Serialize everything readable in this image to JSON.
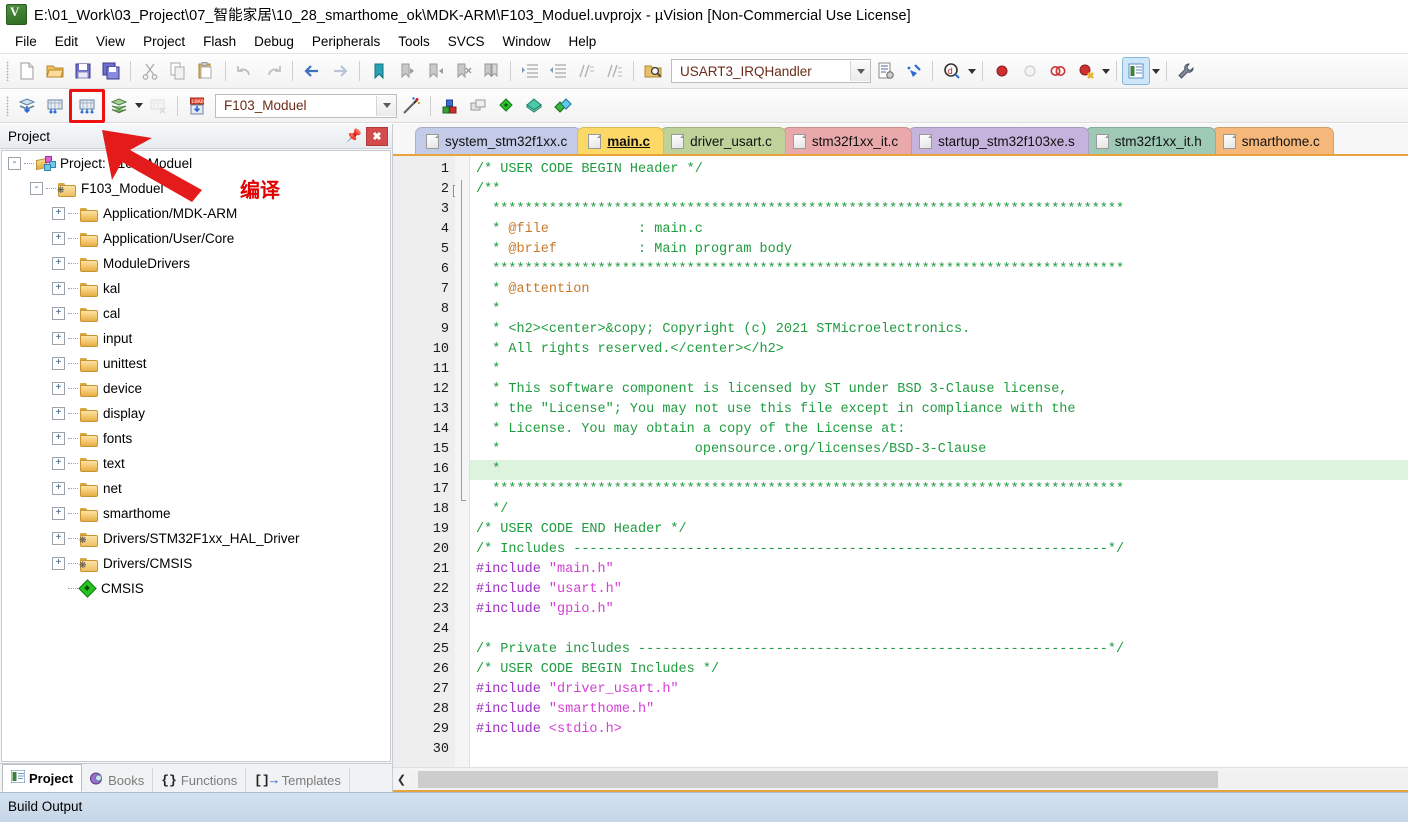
{
  "window": {
    "title": "E:\\01_Work\\03_Project\\07_智能家居\\10_28_smarthome_ok\\MDK-ARM\\F103_Moduel.uvprojx - µVision  [Non-Commercial Use License]",
    "logo_icon": "uvision-logo-icon"
  },
  "menu": {
    "items": [
      {
        "label": "File"
      },
      {
        "label": "Edit"
      },
      {
        "label": "View"
      },
      {
        "label": "Project"
      },
      {
        "label": "Flash"
      },
      {
        "label": "Debug"
      },
      {
        "label": "Peripherals"
      },
      {
        "label": "Tools"
      },
      {
        "label": "SVCS"
      },
      {
        "label": "Window"
      },
      {
        "label": "Help"
      }
    ]
  },
  "toolbar_file": {
    "buttons": [
      {
        "name": "new-file-icon",
        "glyph": "new"
      },
      {
        "name": "open-file-icon",
        "glyph": "open"
      },
      {
        "name": "save-icon",
        "glyph": "save"
      },
      {
        "name": "save-all-icon",
        "glyph": "saveall"
      },
      {
        "name": "cut-icon",
        "glyph": "cut"
      },
      {
        "name": "copy-icon",
        "glyph": "copy"
      },
      {
        "name": "paste-icon",
        "glyph": "paste"
      },
      {
        "name": "undo-icon",
        "glyph": "undo"
      },
      {
        "name": "redo-icon",
        "glyph": "redo"
      },
      {
        "name": "navigate-back-icon",
        "glyph": "back"
      },
      {
        "name": "navigate-forward-icon",
        "glyph": "forward"
      },
      {
        "name": "bookmark-toggle-icon",
        "glyph": "bm"
      },
      {
        "name": "bookmark-prev-icon",
        "glyph": "bmprev"
      },
      {
        "name": "bookmark-next-icon",
        "glyph": "bmnext"
      },
      {
        "name": "bookmark-clear-icon",
        "glyph": "bmclear"
      },
      {
        "name": "bookmark-clear-all-icon",
        "glyph": "bmclearall"
      },
      {
        "name": "indent-icon",
        "glyph": "indent"
      },
      {
        "name": "outdent-icon",
        "glyph": "outdent"
      },
      {
        "name": "comment-icon",
        "glyph": "comment"
      },
      {
        "name": "uncomment-icon",
        "glyph": "uncomment"
      },
      {
        "name": "find-in-files-icon",
        "glyph": "findfiles"
      }
    ],
    "function_combo_value": "USART3_IRQHandler",
    "after_combo": [
      {
        "name": "insert-snippet-icon",
        "glyph": "snippet"
      },
      {
        "name": "configure-icon",
        "glyph": "configure"
      }
    ],
    "right_buttons": [
      {
        "name": "debug-start-icon",
        "glyph": "debug"
      },
      {
        "name": "breakpoint-insert-icon",
        "glyph": "bp"
      },
      {
        "name": "breakpoint-disable-icon",
        "glyph": "bpoff"
      },
      {
        "name": "breakpoint-disable-all-icon",
        "glyph": "bpdisall"
      },
      {
        "name": "breakpoint-kill-all-icon",
        "glyph": "bpkill"
      },
      {
        "name": "manage-windows-icon",
        "glyph": "winmanage"
      },
      {
        "name": "configure-target-icon",
        "glyph": "wrench"
      }
    ]
  },
  "toolbar_build": {
    "buttons": [
      {
        "name": "translate-file-button",
        "glyph": "translate",
        "state": "normal"
      },
      {
        "name": "build-target-button",
        "glyph": "build",
        "state": "normal"
      },
      {
        "name": "rebuild-all-button",
        "glyph": "rebuild",
        "state": "highlighted"
      },
      {
        "name": "batch-build-button",
        "glyph": "batchbuild",
        "state": "normal"
      },
      {
        "name": "stop-build-button",
        "glyph": "stopbuild",
        "state": "disabled"
      },
      {
        "name": "download-button",
        "glyph": "load",
        "state": "normal"
      }
    ],
    "target_combo_value": "F103_Moduel",
    "after_target": [
      {
        "name": "target-options-icon",
        "glyph": "magicwand"
      },
      {
        "name": "manage-project-items-icon",
        "glyph": "projitems"
      },
      {
        "name": "manage-multi-project-icon",
        "glyph": "multiproj"
      },
      {
        "name": "pack-installer-icon",
        "glyph": "packinstaller"
      },
      {
        "name": "manage-run-time-env-icon",
        "glyph": "rte"
      },
      {
        "name": "select-software-packs-icon",
        "glyph": "softpacks"
      }
    ]
  },
  "annotation": {
    "label": "编译",
    "color": "#e00000",
    "arrow_name": "red-annotation-arrow",
    "target": "rebuild-all-button"
  },
  "project_panel": {
    "header_title": "Project",
    "pin_icon": "pin-icon",
    "close_icon": "close-icon",
    "tree": [
      {
        "label": "Project: F103_Moduel",
        "depth": 0,
        "expander": "-",
        "icon": "project-root-icon"
      },
      {
        "label": "F103_Moduel",
        "depth": 1,
        "expander": "-",
        "icon": "target-folder-icon"
      },
      {
        "label": "Application/MDK-ARM",
        "depth": 2,
        "expander": "+",
        "icon": "folder-icon"
      },
      {
        "label": "Application/User/Core",
        "depth": 2,
        "expander": "+",
        "icon": "folder-icon"
      },
      {
        "label": "ModuleDrivers",
        "depth": 2,
        "expander": "+",
        "icon": "folder-icon"
      },
      {
        "label": "kal",
        "depth": 2,
        "expander": "+",
        "icon": "folder-icon"
      },
      {
        "label": "cal",
        "depth": 2,
        "expander": "+",
        "icon": "folder-icon"
      },
      {
        "label": "input",
        "depth": 2,
        "expander": "+",
        "icon": "folder-icon"
      },
      {
        "label": "unittest",
        "depth": 2,
        "expander": "+",
        "icon": "folder-icon"
      },
      {
        "label": "device",
        "depth": 2,
        "expander": "+",
        "icon": "folder-icon"
      },
      {
        "label": "display",
        "depth": 2,
        "expander": "+",
        "icon": "folder-icon"
      },
      {
        "label": "fonts",
        "depth": 2,
        "expander": "+",
        "icon": "folder-icon"
      },
      {
        "label": "text",
        "depth": 2,
        "expander": "+",
        "icon": "folder-icon"
      },
      {
        "label": "net",
        "depth": 2,
        "expander": "+",
        "icon": "folder-icon"
      },
      {
        "label": "smarthome",
        "depth": 2,
        "expander": "+",
        "icon": "folder-icon"
      },
      {
        "label": "Drivers/STM32F1xx_HAL_Driver",
        "depth": 2,
        "expander": "+",
        "icon": "component-folder-icon"
      },
      {
        "label": "Drivers/CMSIS",
        "depth": 2,
        "expander": "+",
        "icon": "component-folder-icon"
      },
      {
        "label": "CMSIS",
        "depth": 2,
        "expander": "",
        "icon": "cmsis-diamond-icon"
      }
    ],
    "bottom_tabs": [
      {
        "label": "Project",
        "icon": "project-tab-icon",
        "selected": true
      },
      {
        "label": "Books",
        "icon": "books-tab-icon",
        "selected": false
      },
      {
        "label": "Functions",
        "icon": "functions-tab-icon",
        "selected": false
      },
      {
        "label": "Templates",
        "icon": "templates-tab-icon",
        "selected": false
      }
    ]
  },
  "editor": {
    "tabs": [
      {
        "label": "system_stm32f1xx.c",
        "color": "#c3cbe8",
        "text_color": "#111111",
        "selected": false
      },
      {
        "label": "main.c",
        "color": "#fcd966",
        "text_color": "#111111",
        "selected": true
      },
      {
        "label": "driver_usart.c",
        "color": "#bfd29a",
        "text_color": "#111111",
        "selected": false
      },
      {
        "label": "stm32f1xx_it.c",
        "color": "#e9a9ab",
        "text_color": "#111111",
        "selected": false
      },
      {
        "label": "startup_stm32f103xe.s",
        "color": "#c6b3dd",
        "text_color": "#111111",
        "selected": false
      },
      {
        "label": "stm32f1xx_it.h",
        "color": "#9dc9b5",
        "text_color": "#111111",
        "selected": false
      },
      {
        "label": "smarthome.c",
        "color": "#f5b87a",
        "text_color": "#111111",
        "selected": false
      }
    ],
    "highlight_line": 16,
    "first_line": 1,
    "lines": [
      {
        "n": 1,
        "segs": [
          {
            "t": "/* USER CODE BEGIN Header */",
            "c": "cm"
          }
        ]
      },
      {
        "n": 2,
        "segs": [
          {
            "t": "/**",
            "c": "cm"
          }
        ],
        "fold": "-"
      },
      {
        "n": 3,
        "segs": [
          {
            "t": "  ******************************************************************************",
            "c": "cm"
          }
        ]
      },
      {
        "n": 4,
        "segs": [
          {
            "t": "  * ",
            "c": "cm"
          },
          {
            "t": "@file",
            "c": "doc"
          },
          {
            "t": "           : main.c",
            "c": "cm"
          }
        ]
      },
      {
        "n": 5,
        "segs": [
          {
            "t": "  * ",
            "c": "cm"
          },
          {
            "t": "@brief",
            "c": "doc"
          },
          {
            "t": "          : Main program body",
            "c": "cm"
          }
        ]
      },
      {
        "n": 6,
        "segs": [
          {
            "t": "  ******************************************************************************",
            "c": "cm"
          }
        ]
      },
      {
        "n": 7,
        "segs": [
          {
            "t": "  * ",
            "c": "cm"
          },
          {
            "t": "@attention",
            "c": "doc"
          }
        ]
      },
      {
        "n": 8,
        "segs": [
          {
            "t": "  *",
            "c": "cm"
          }
        ]
      },
      {
        "n": 9,
        "segs": [
          {
            "t": "  * <h2><center>&copy; Copyright (c) 2021 STMicroelectronics.",
            "c": "cm"
          }
        ]
      },
      {
        "n": 10,
        "segs": [
          {
            "t": "  * All rights reserved.</center></h2>",
            "c": "cm"
          }
        ]
      },
      {
        "n": 11,
        "segs": [
          {
            "t": "  *",
            "c": "cm"
          }
        ]
      },
      {
        "n": 12,
        "segs": [
          {
            "t": "  * This software component is licensed by ST under BSD 3-Clause license,",
            "c": "cm"
          }
        ]
      },
      {
        "n": 13,
        "segs": [
          {
            "t": "  * the \"License\"; You may not use this file except in compliance with the",
            "c": "cm"
          }
        ]
      },
      {
        "n": 14,
        "segs": [
          {
            "t": "  * License. You may obtain a copy of the License at:",
            "c": "cm"
          }
        ]
      },
      {
        "n": 15,
        "segs": [
          {
            "t": "  *                        opensource.org/licenses/BSD-3-Clause",
            "c": "cm"
          }
        ]
      },
      {
        "n": 16,
        "segs": [
          {
            "t": "  *",
            "c": "cm"
          }
        ]
      },
      {
        "n": 17,
        "segs": [
          {
            "t": "  ******************************************************************************",
            "c": "cm"
          }
        ]
      },
      {
        "n": 18,
        "segs": [
          {
            "t": "  */",
            "c": "cm"
          }
        ],
        "fold": "end"
      },
      {
        "n": 19,
        "segs": [
          {
            "t": "/* USER CODE END Header */",
            "c": "cm"
          }
        ]
      },
      {
        "n": 20,
        "segs": [
          {
            "t": "/* Includes ------------------------------------------------------------------*/",
            "c": "cm"
          }
        ]
      },
      {
        "n": 21,
        "segs": [
          {
            "t": "#include ",
            "c": "pp"
          },
          {
            "t": "\"main.h\"",
            "c": "str"
          }
        ]
      },
      {
        "n": 22,
        "segs": [
          {
            "t": "#include ",
            "c": "pp"
          },
          {
            "t": "\"usart.h\"",
            "c": "str"
          }
        ]
      },
      {
        "n": 23,
        "segs": [
          {
            "t": "#include ",
            "c": "pp"
          },
          {
            "t": "\"gpio.h\"",
            "c": "str"
          }
        ]
      },
      {
        "n": 24,
        "segs": [
          {
            "t": "",
            "c": "plain"
          }
        ]
      },
      {
        "n": 25,
        "segs": [
          {
            "t": "/* Private includes ----------------------------------------------------------*/",
            "c": "cm"
          }
        ]
      },
      {
        "n": 26,
        "segs": [
          {
            "t": "/* USER CODE BEGIN Includes */",
            "c": "cm"
          }
        ]
      },
      {
        "n": 27,
        "segs": [
          {
            "t": "#include ",
            "c": "pp"
          },
          {
            "t": "\"driver_usart.h\"",
            "c": "str"
          }
        ]
      },
      {
        "n": 28,
        "segs": [
          {
            "t": "#include ",
            "c": "pp"
          },
          {
            "t": "\"smarthome.h\"",
            "c": "str"
          }
        ]
      },
      {
        "n": 29,
        "segs": [
          {
            "t": "#include ",
            "c": "pp"
          },
          {
            "t": "<stdio.h>",
            "c": "str"
          }
        ]
      },
      {
        "n": 30,
        "segs": [
          {
            "t": "",
            "c": "plain"
          }
        ]
      }
    ],
    "hscroll_left_icon": "scroll-left-arrow-icon"
  },
  "build_output": {
    "title": "Build Output"
  },
  "colors": {
    "comment_green": "#1f9c3f",
    "doc_tag_orange": "#c7792b",
    "preprocessor_purple": "#9b30c0",
    "string_magenta": "#d43fd4",
    "current_line_bg": "#ddf3dd",
    "annotation_red": "#e00000",
    "tab_underline_orange": "#e8a33d"
  }
}
